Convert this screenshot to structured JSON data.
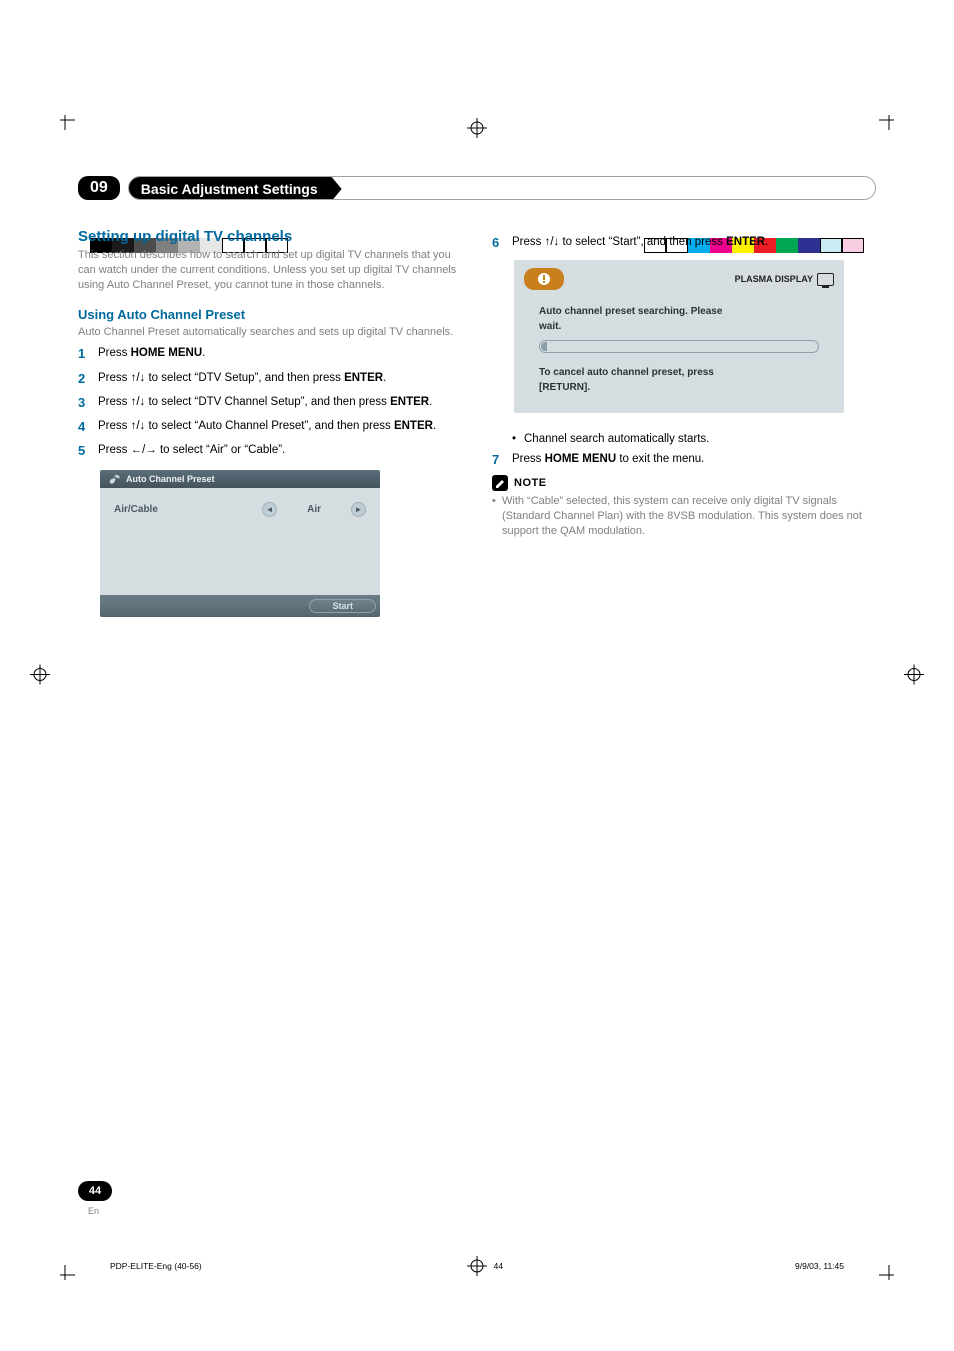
{
  "chapter": {
    "number": "09",
    "title": "Basic Adjustment Settings"
  },
  "section": {
    "heading": "Setting up digital TV channels",
    "intro": "This section describes how to search and set up digital TV channels that you can watch under the current conditions. Unless you set up digital TV channels using Auto Channel Preset, you cannot tune in those channels."
  },
  "sub": {
    "heading": "Using Auto Channel Preset",
    "intro": "Auto Channel Preset automatically searches and sets up digital TV channels."
  },
  "steps_left": {
    "s1": {
      "n": "1",
      "pre": "Press ",
      "b": "HOME MENU",
      "post": "."
    },
    "s2": {
      "n": "2",
      "t": "Press ↑/↓ to select “DTV Setup”, and then press ",
      "b": "ENTER",
      "post": "."
    },
    "s3": {
      "n": "3",
      "t": "Press ↑/↓ to select “DTV Channel Setup”, and then press ",
      "b": "ENTER",
      "post": "."
    },
    "s4": {
      "n": "4",
      "t": "Press ↑/↓ to select “Auto Channel Preset”, and then press ",
      "b": "ENTER",
      "post": "."
    },
    "s5": {
      "n": "5",
      "t": "Press ←/→ to select “Air” or “Cable”."
    }
  },
  "ui_panel": {
    "title": "Auto Channel Preset",
    "row_label": "Air/Cable",
    "row_value": "Air",
    "start": "Start"
  },
  "steps_right": {
    "s6": {
      "n": "6",
      "t": "Press ↑/↓ to select “Start”, and then press ",
      "b": "ENTER",
      "post": "."
    },
    "bullet": "Channel search automatically starts.",
    "s7": {
      "n": "7",
      "pre": "Press ",
      "b": "HOME MENU",
      "post": " to exit the menu."
    }
  },
  "dialog": {
    "brand": "PLASMA DISPLAY",
    "line1": "Auto channel preset searching. Please",
    "line2": "wait.",
    "line3": "To cancel auto channel preset, press",
    "line4": "[RETURN]."
  },
  "note": {
    "label": "NOTE",
    "text": "With “Cable” selected, this system can receive only digital TV signals (Standard Channel Plan) with the 8VSB modulation. This system does not support the QAM modulation."
  },
  "page": {
    "number": "44",
    "lang": "En"
  },
  "footer": {
    "left": "PDP-ELITE-Eng (40-56)",
    "mid": "44",
    "right": "9/9/03, 11:45"
  }
}
